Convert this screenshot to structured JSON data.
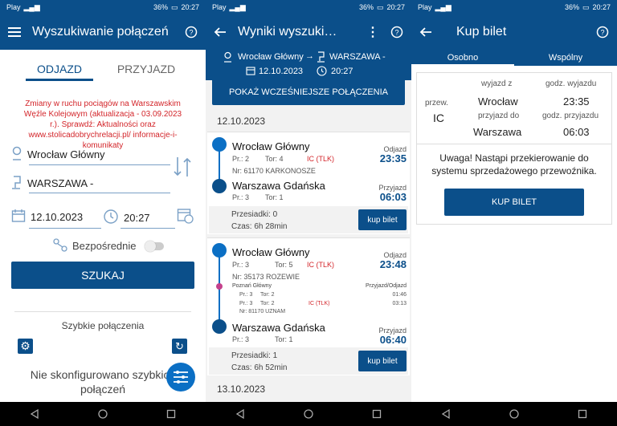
{
  "status": {
    "carrier": "Play",
    "battery": "36%",
    "time": "20:27"
  },
  "p1": {
    "title": "Wyszukiwanie połączeń",
    "tab_dep": "ODJAZD",
    "tab_arr": "PRZYJAZD",
    "notice": "Zmiany w ruchu pociągów na Warszawskim Węźle Kolejowym (aktualizacja - 03.09.2023 r.). Sprawdź: Aktualności oraz www.stolicadobrychrelacji.pl/ informacje-i-komunikaty",
    "from": "Wrocław Główny",
    "to": "WARSZAWA -",
    "date": "12.10.2023",
    "time": "20:27",
    "direct_label": "Bezpośrednie",
    "search_btn": "SZUKAJ",
    "quick_title": "Szybkie połączenia",
    "quick_empty": "Nie skonfigurowano szybkich połączeń"
  },
  "p2": {
    "title": "Wyniki wyszuki…",
    "from": "Wrocław Główny",
    "to": "WARSZAWA -",
    "date": "12.10.2023",
    "time": "20:27",
    "earlier_btn": "POKAŻ WCZEŚNIEJSZE POŁĄCZENIA",
    "date1": "12.10.2023",
    "date2": "13.10.2023",
    "c1": {
      "from": "Wrocław Główny",
      "dep_label": "Odjazd",
      "dep": "23:35",
      "pr": "Pr.: 2",
      "tor": "Tor: 4",
      "cat": "IC (TLK)",
      "nr": "Nr: 61170 KARKONOSZE",
      "to": "Warszawa Gdańska",
      "arr_label": "Przyjazd",
      "arr": "06:03",
      "pr2": "Pr.: 3",
      "tor2": "Tor: 1",
      "transfers": "Przesiadki: 0",
      "duration": "Czas: 6h 28min",
      "buy": "kup bilet"
    },
    "c2": {
      "from": "Wrocław Główny",
      "dep_label": "Odjazd",
      "dep": "23:48",
      "pr": "Pr.: 3",
      "tor": "Tor: 5",
      "cat": "IC (TLK)",
      "nr": "Nr: 35173 ROZEWIE",
      "via": "Poznań Główny",
      "via_label": "Przyjazd/Odjazd",
      "via_pr1": "Pr.: 3",
      "via_tor1": "Tor: 2",
      "via_pr2": "Pr.: 3",
      "via_tor2": "Tor: 2",
      "via_cat": "IC (TLK)",
      "via_arr": "01:46",
      "via_dep": "03:13",
      "via_nr": "Nr: 81170 UZNAM",
      "to": "Warszawa Gdańska",
      "arr_label": "Przyjazd",
      "arr": "06:40",
      "pr2": "Pr.: 3",
      "tor2": "Tor: 1",
      "transfers": "Przesiadki: 1",
      "duration": "Czas: 6h 52min",
      "buy": "kup bilet"
    }
  },
  "p3": {
    "title": "Kup bilet",
    "tab1": "Osobno",
    "tab2": "Wspólny",
    "h_from": "wyjazd z",
    "h_dep": "godz. wyjazdu",
    "carrier_lbl": "przew.",
    "carrier": "IC",
    "from": "Wrocław",
    "dep": "23:35",
    "h_to": "przyjazd do",
    "h_arr": "godz. przyjazdu",
    "to": "Warszawa",
    "arr": "06:03",
    "warning": "Uwaga! Nastąpi przekierowanie do systemu sprzedażowego przewoźnika.",
    "buy_btn": "KUP BILET"
  }
}
